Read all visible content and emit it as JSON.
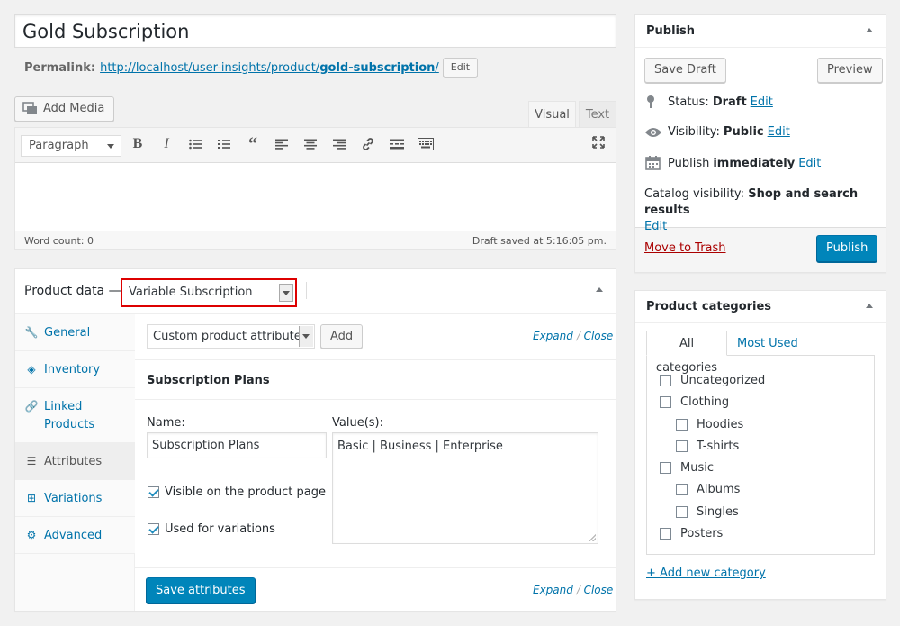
{
  "post": {
    "title": "Gold Subscription",
    "permalink_label": "Permalink:",
    "permalink_base": "http://localhost/user-insights/product/",
    "permalink_slug": "gold-subscription",
    "permalink_trail": "/",
    "permalink_edit": "Edit"
  },
  "editor": {
    "add_media": "Add Media",
    "tab_visual": "Visual",
    "tab_text": "Text",
    "format_select": "Paragraph",
    "word_count": "Word count: 0",
    "draft_saved": "Draft saved at 5:16:05 pm."
  },
  "product_data": {
    "label": "Product data —",
    "type_select": "Variable Subscription",
    "tabs": [
      {
        "label": "General",
        "icon": "wrench-icon"
      },
      {
        "label": "Inventory",
        "icon": "tag-icon"
      },
      {
        "label": "Linked Products",
        "icon": "link-icon"
      },
      {
        "label": "Attributes",
        "icon": "list-icon"
      },
      {
        "label": "Variations",
        "icon": "grid-icon"
      },
      {
        "label": "Advanced",
        "icon": "gear-icon"
      }
    ],
    "attribute_select": "Custom product attribute",
    "add_button": "Add",
    "expand": "Expand",
    "sep": "/",
    "close": "Close",
    "attribute_title": "Subscription Plans",
    "name_label": "Name:",
    "name_value": "Subscription Plans",
    "values_label": "Value(s):",
    "values_value": "Basic | Business | Enterprise",
    "visible_label": "Visible on the product page",
    "variations_label": "Used for variations",
    "save_attributes": "Save attributes"
  },
  "publish": {
    "title": "Publish",
    "save_draft": "Save Draft",
    "preview": "Preview",
    "status_label": "Status:",
    "status_value": "Draft",
    "visibility_label": "Visibility:",
    "visibility_value": "Public",
    "publish_label": "Publish",
    "publish_value": "immediately",
    "catalog_label": "Catalog visibility:",
    "catalog_value": "Shop and search results",
    "edit": "Edit",
    "move_to_trash": "Move to Trash",
    "publish_button": "Publish"
  },
  "categories": {
    "title": "Product categories",
    "tab_all": "All categories",
    "tab_most_used": "Most Used",
    "items": [
      {
        "label": "Uncategorized",
        "level": 0
      },
      {
        "label": "Clothing",
        "level": 0
      },
      {
        "label": "Hoodies",
        "level": 1
      },
      {
        "label": "T-shirts",
        "level": 1
      },
      {
        "label": "Music",
        "level": 0
      },
      {
        "label": "Albums",
        "level": 1
      },
      {
        "label": "Singles",
        "level": 1
      },
      {
        "label": "Posters",
        "level": 0
      }
    ],
    "add_new": "+ Add new category"
  },
  "colors": {
    "link": "#0073aa",
    "primary": "#0085ba",
    "highlight": "#dd0000"
  }
}
